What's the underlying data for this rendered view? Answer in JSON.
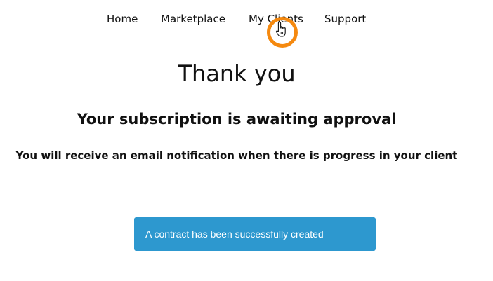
{
  "nav": {
    "items": [
      {
        "label": "Home"
      },
      {
        "label": "Marketplace"
      },
      {
        "label": "My Clients"
      },
      {
        "label": "Support"
      }
    ]
  },
  "main": {
    "title": "Thank you",
    "subtitle": "Your subscription is awaiting approval",
    "note": "You will receive an email notification when there is progress in your client"
  },
  "alert": {
    "message": "A contract has been successfully created"
  },
  "colors": {
    "alert_background": "#2d98cf",
    "cursor_highlight": "#f5890f",
    "text": "#111111"
  },
  "icons": {
    "cursor": "hand-pointer-icon",
    "cursor_highlight": "click-highlight-ring"
  }
}
